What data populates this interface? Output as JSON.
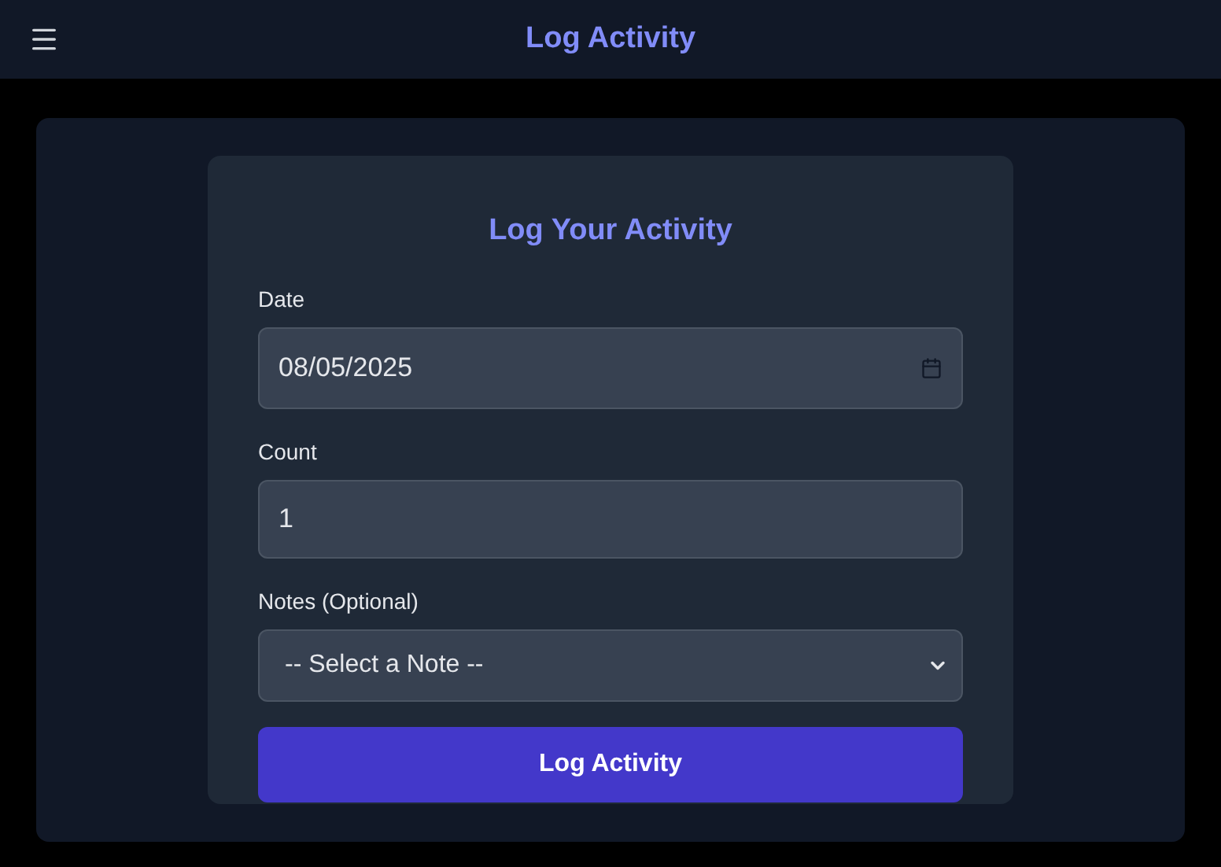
{
  "header": {
    "title": "Log Activity"
  },
  "form": {
    "title": "Log Your Activity",
    "fields": [
      {
        "kind": "date",
        "label": "Date",
        "value": "08/05/2025"
      },
      {
        "kind": "number",
        "label": "Count",
        "value": "1"
      },
      {
        "kind": "select",
        "label": "Notes (Optional)",
        "value": "-- Select a Note --"
      }
    ],
    "submit": "Log Activity"
  }
}
